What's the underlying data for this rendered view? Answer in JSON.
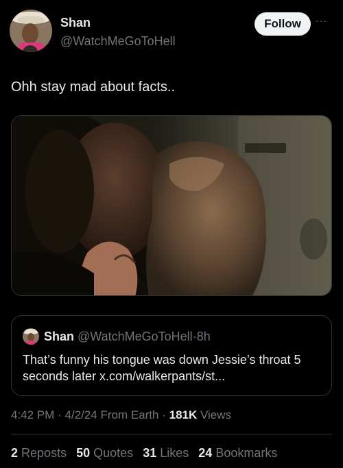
{
  "author": {
    "name": "Shan",
    "handle": "@WatchMeGoToHell",
    "follow_label": "Follow",
    "more_glyph": "···"
  },
  "tweet": {
    "text": "Ohh stay mad about facts.."
  },
  "quote": {
    "name": "Shan",
    "handle": "@WatchMeGoToHell",
    "separator": "·",
    "age": "8h",
    "text": "That’s funny his tongue was down Jessie’s throat 5 seconds later x.com/walkerpants/st..."
  },
  "meta": {
    "time": "4:42 PM",
    "sep1": "·",
    "date": "4/2/24",
    "source": "From Earth",
    "sep2": "·",
    "views_count": "181K",
    "views_label": "Views"
  },
  "stats": {
    "reposts_count": "2",
    "reposts_label": "Reposts",
    "quotes_count": "50",
    "quotes_label": "Quotes",
    "likes_count": "31",
    "likes_label": "Likes",
    "bookmarks_count": "24",
    "bookmarks_label": "Bookmarks"
  },
  "colors": {
    "background": "#000000",
    "primary_text": "#e7e9ea",
    "secondary_text": "#71767b",
    "border": "#2f3336",
    "follow_bg": "#eff3f4"
  }
}
